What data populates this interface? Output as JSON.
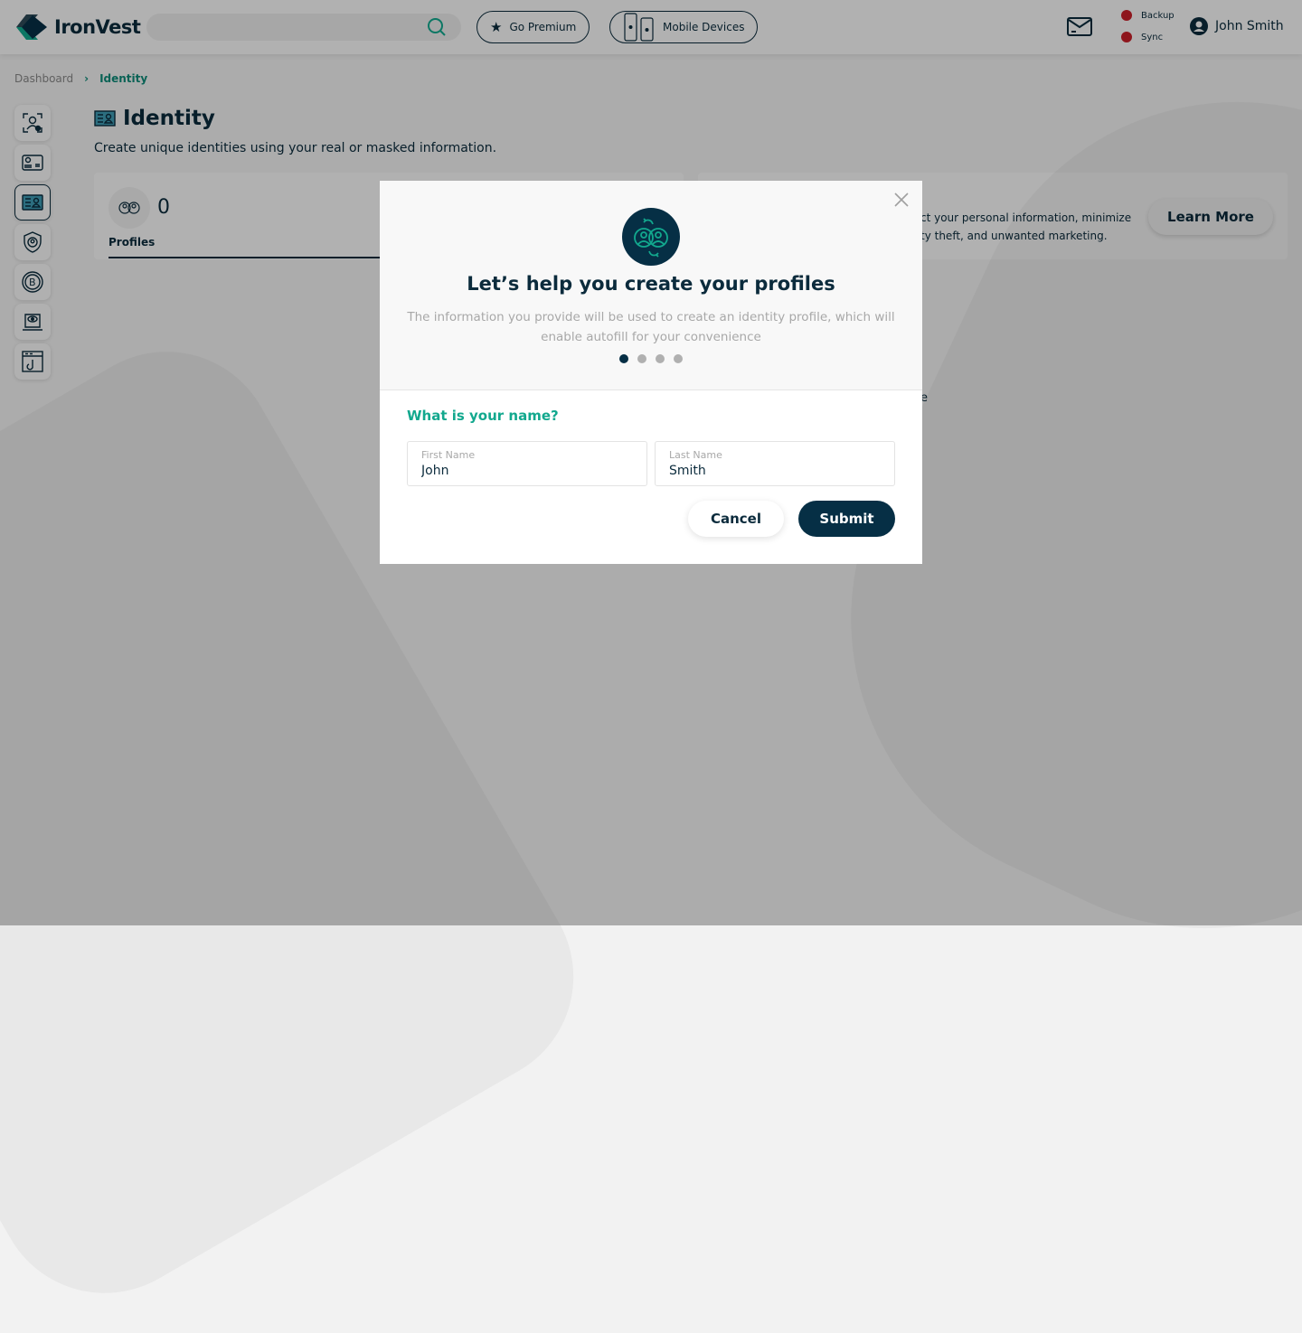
{
  "header": {
    "brand": "IronVest",
    "search_placeholder": "",
    "premium": "Go Premium",
    "mobile": "Mobile Devices",
    "backup": "Backup",
    "sync": "Sync",
    "user": "John Smith"
  },
  "breadcrumb": {
    "root": "Dashboard",
    "current": "Identity"
  },
  "sidebar": {
    "items": [
      "face-scan-icon",
      "card-icon",
      "identity-icon",
      "shield-icon",
      "bitcoin-icon",
      "laptop-eye-icon",
      "phishing-icon"
    ],
    "active": 2
  },
  "page": {
    "title": "Identity",
    "subtitle": "Create unique identities using your real or masked information.",
    "profiles_count": "0",
    "profiles_label": "Profiles",
    "info_line1": "ct your personal information, minimize",
    "info_line2": "ty theft, and unwanted marketing.",
    "learn_more": "Learn More",
    "partial": "e"
  },
  "modal": {
    "title": "Let’s help you create your profiles",
    "desc": "The information you provide will be used to create an identity profile, which will enable autofill for your convenience",
    "steps": 4,
    "current_step": 1,
    "question": "What is your name?",
    "first_label": "First Name",
    "first_value": "John",
    "last_label": "Last Name",
    "last_value": "Smith",
    "cancel": "Cancel",
    "submit": "Submit"
  },
  "colors": {
    "navy": "#0b2b3c",
    "teal": "#12a88e",
    "status_red": "#c8202a"
  }
}
